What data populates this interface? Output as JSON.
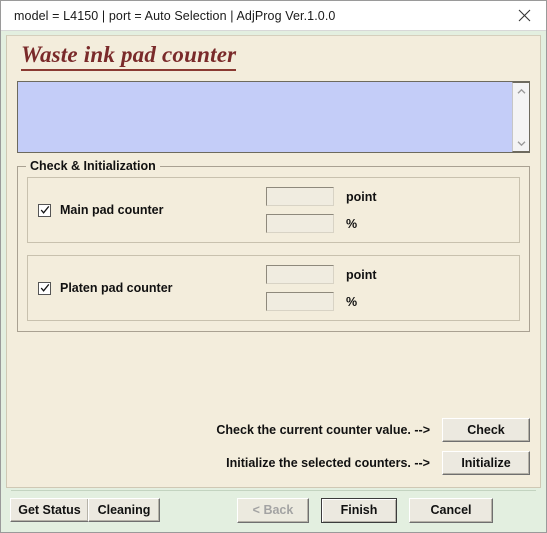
{
  "window": {
    "title": "model = L4150 | port = Auto Selection | AdjProg Ver.1.0.0",
    "close_icon": "close-icon"
  },
  "heading": "Waste ink pad counter",
  "log": {
    "content": "",
    "scroll_up_icon": "chevron-up-icon",
    "scroll_down_icon": "chevron-down-icon"
  },
  "groupbox": {
    "legend": "Check & Initialization",
    "counters": [
      {
        "label": "Main pad counter",
        "checked": true,
        "point_value": "",
        "point_unit": "point",
        "percent_value": "",
        "percent_unit": "%"
      },
      {
        "label": "Platen pad counter",
        "checked": true,
        "point_value": "",
        "point_unit": "point",
        "percent_value": "",
        "percent_unit": "%"
      }
    ]
  },
  "actions": [
    {
      "text": "Check the current counter value. -->",
      "button": "Check"
    },
    {
      "text": "Initialize the selected counters. -->",
      "button": "Initialize"
    }
  ],
  "footer": {
    "get_status": "Get Status",
    "cleaning": "Cleaning",
    "back": "< Back",
    "finish": "Finish",
    "cancel": "Cancel"
  },
  "colors": {
    "window_frame": "#e3efe0",
    "panel_bg": "#f3eddc",
    "log_bg": "#c4cdf8",
    "heading_text": "#7a2a2a",
    "button_face": "#ece9e0"
  }
}
